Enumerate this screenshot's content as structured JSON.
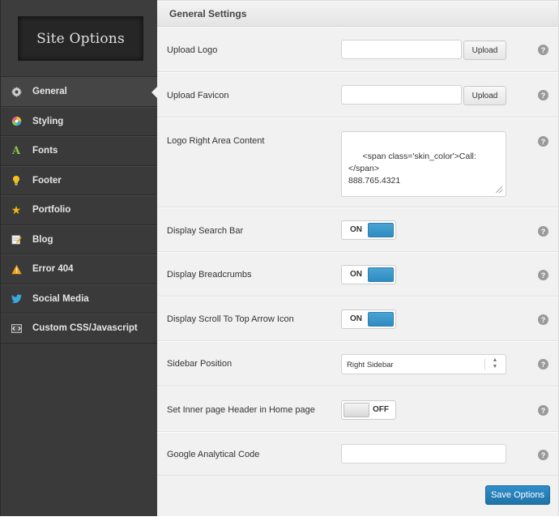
{
  "sidebar": {
    "logo_text": "Site Options",
    "items": [
      {
        "label": "General",
        "icon": "gear-icon",
        "color": "#cfcfcf"
      },
      {
        "label": "Styling",
        "icon": "color-wheel-icon",
        "color": "#e05a9a"
      },
      {
        "label": "Fonts",
        "icon": "font-icon",
        "color": "#8fc34a"
      },
      {
        "label": "Footer",
        "icon": "lightbulb-icon",
        "color": "#f2c01e"
      },
      {
        "label": "Portfolio",
        "icon": "star-icon",
        "color": "#f5b915"
      },
      {
        "label": "Blog",
        "icon": "notepad-icon",
        "color": "#e8e8e8"
      },
      {
        "label": "Error 404",
        "icon": "warning-icon",
        "color": "#f0a21c"
      },
      {
        "label": "Social Media",
        "icon": "twitter-bird-icon",
        "color": "#39a9e0"
      },
      {
        "label": "Custom CSS/Javascript",
        "icon": "code-icon",
        "color": "#dddddd"
      }
    ]
  },
  "header": {
    "title": "General Settings"
  },
  "fields": {
    "upload_logo": {
      "label": "Upload Logo",
      "value": "",
      "button": "Upload"
    },
    "upload_favicon": {
      "label": "Upload Favicon",
      "value": "",
      "button": "Upload"
    },
    "logo_right": {
      "label": "Logo Right Area Content",
      "value": "<span class='skin_color'>Call:</span>\n888.765.4321"
    },
    "search_bar": {
      "label": "Display Search Bar",
      "state": "ON"
    },
    "breadcrumbs": {
      "label": "Display Breadcrumbs",
      "state": "ON"
    },
    "scroll_top": {
      "label": "Display Scroll To Top Arrow Icon",
      "state": "ON"
    },
    "sidebar_position": {
      "label": "Sidebar Position",
      "value": "Right Sidebar"
    },
    "inner_header": {
      "label": "Set Inner page Header in Home page",
      "state": "OFF"
    },
    "analytics": {
      "label": "Google Analytical Code",
      "value": ""
    }
  },
  "help_symbol": "?",
  "save_button": "Save Options",
  "colors": {
    "accent": "#2f8cc1",
    "sidebar_bg": "#3a3a3a",
    "main_bg": "#f1f1f1"
  }
}
